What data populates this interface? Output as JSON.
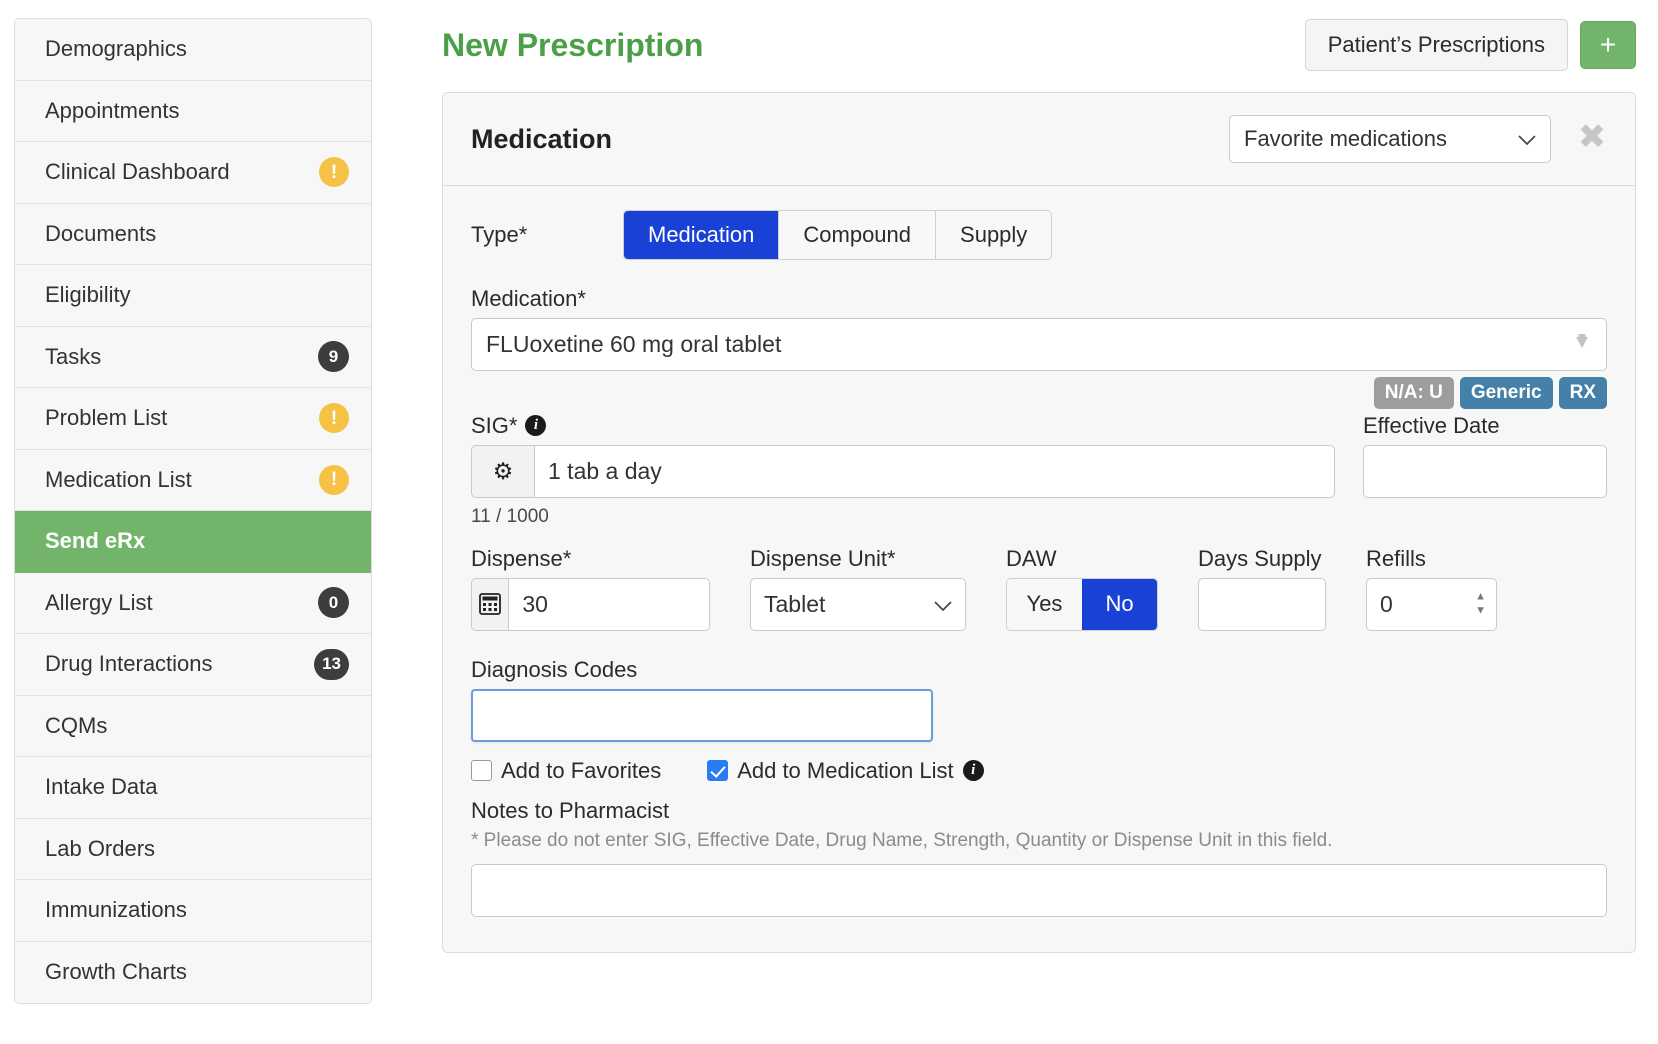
{
  "sidebar": {
    "items": [
      {
        "label": "Demographics",
        "badge": null,
        "badge_type": null,
        "active": false
      },
      {
        "label": "Appointments",
        "badge": null,
        "badge_type": null,
        "active": false
      },
      {
        "label": "Clinical Dashboard",
        "badge": "!",
        "badge_type": "warn",
        "active": false
      },
      {
        "label": "Documents",
        "badge": null,
        "badge_type": null,
        "active": false
      },
      {
        "label": "Eligibility",
        "badge": null,
        "badge_type": null,
        "active": false
      },
      {
        "label": "Tasks",
        "badge": "9",
        "badge_type": "count",
        "active": false
      },
      {
        "label": "Problem List",
        "badge": "!",
        "badge_type": "warn",
        "active": false
      },
      {
        "label": "Medication List",
        "badge": "!",
        "badge_type": "warn",
        "active": false
      },
      {
        "label": "Send eRx",
        "badge": null,
        "badge_type": null,
        "active": true
      },
      {
        "label": "Allergy List",
        "badge": "0",
        "badge_type": "count",
        "active": false
      },
      {
        "label": "Drug Interactions",
        "badge": "13",
        "badge_type": "count",
        "active": false
      },
      {
        "label": "CQMs",
        "badge": null,
        "badge_type": null,
        "active": false
      },
      {
        "label": "Intake Data",
        "badge": null,
        "badge_type": null,
        "active": false
      },
      {
        "label": "Lab Orders",
        "badge": null,
        "badge_type": null,
        "active": false
      },
      {
        "label": "Immunizations",
        "badge": null,
        "badge_type": null,
        "active": false
      },
      {
        "label": "Growth Charts",
        "badge": null,
        "badge_type": null,
        "active": false
      }
    ]
  },
  "header": {
    "title": "New Prescription",
    "patients_prescriptions_label": "Patient’s Prescriptions",
    "add_label": "+"
  },
  "card": {
    "title": "Medication",
    "favorites_select_value": "Favorite medications",
    "caret_glyph": "⌄",
    "close_glyph": "✖"
  },
  "form": {
    "type_label": "Type*",
    "type_options": [
      {
        "label": "Medication",
        "selected": true
      },
      {
        "label": "Compound",
        "selected": false
      },
      {
        "label": "Supply",
        "selected": false
      }
    ],
    "medication_label": "Medication*",
    "medication_value": "FLUoxetine 60 mg oral tablet",
    "medication_arrow_glyph": "⬇",
    "pills": [
      {
        "text": "N/A: U",
        "color": "#9d9d9d",
        "style": "gray"
      },
      {
        "text": "Generic",
        "color": "#4480a8",
        "style": "blue"
      },
      {
        "text": "RX",
        "color": "#4480a8",
        "style": "blue"
      }
    ],
    "sig_label": "SIG*",
    "sig_info_glyph": "i",
    "sig_gear_glyph": "⚙",
    "sig_value": "1 tab a day",
    "sig_char_count": "11 / 1000",
    "effective_date_label": "Effective Date",
    "effective_date_value": "",
    "dispense_label": "Dispense*",
    "dispense_calc_glyph": "⌸",
    "dispense_value": "30",
    "dispense_unit_label": "Dispense Unit*",
    "dispense_unit_value": "Tablet",
    "daw_label": "DAW",
    "daw_options": [
      {
        "label": "Yes",
        "selected": false
      },
      {
        "label": "No",
        "selected": true
      }
    ],
    "days_supply_label": "Days Supply",
    "days_supply_value": "",
    "refills_label": "Refills",
    "refills_value": "0",
    "spin_up_glyph": "▲",
    "spin_down_glyph": "▼",
    "diagnosis_codes_label": "Diagnosis Codes",
    "diagnosis_codes_value": "",
    "add_to_favorites_label": "Add to Favorites",
    "add_to_favorites_checked": false,
    "add_to_medication_list_label": "Add to Medication List",
    "add_to_medication_list_checked": true,
    "add_to_medication_list_info_glyph": "i",
    "notes_label": "Notes to Pharmacist",
    "notes_hint": "* Please do not enter SIG, Effective Date, Drug Name, Strength, Quantity or Dispense Unit in this field.",
    "notes_value": ""
  },
  "colors": {
    "accent_green": "#72b56a",
    "title_green": "#4ba047",
    "primary_blue": "#1a41d6",
    "badge_blue": "#4480a8",
    "badge_gray": "#9d9d9d",
    "warn_yellow": "#f5c246",
    "focus_blue": "#6b9bd8"
  }
}
